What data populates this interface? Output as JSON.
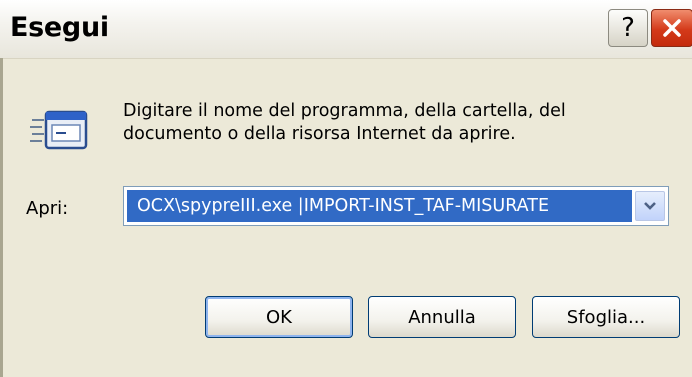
{
  "window": {
    "title": "Esegui",
    "help_glyph": "?",
    "accent": "#316ac5",
    "close_color": "#d43a1a"
  },
  "description": {
    "line1": "Digitare il nome del programma, della cartella, del",
    "line2": "documento o della risorsa Internet da aprire."
  },
  "open_field": {
    "label": "Apri:",
    "value": "OCX\\spypreIII.exe |IMPORT-INST_TAF-MISURATE"
  },
  "buttons": {
    "ok": "OK",
    "cancel": "Annulla",
    "browse": "Sfoglia..."
  }
}
